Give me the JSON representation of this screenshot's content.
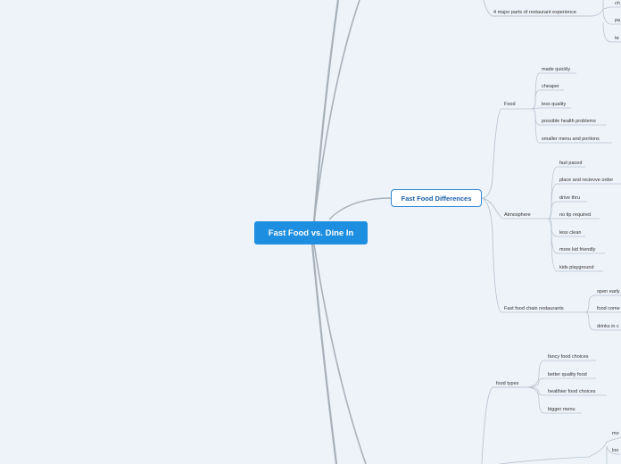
{
  "root": {
    "label": "Fast Food vs. Dine In"
  },
  "main_topic": {
    "label": "Fast Food Differences"
  },
  "top_partial": {
    "label": "4 major parts of restaurant experience",
    "children": [
      "ch",
      "pa",
      "ta"
    ]
  },
  "food": {
    "label": "Food",
    "children": [
      "made quickly",
      "cheaper",
      "less quality",
      "possible health problems",
      "smaller menu and portions"
    ]
  },
  "atmosphere": {
    "label": "Atmosphere",
    "children": [
      "fast paced",
      "place and recievve order",
      "drive thru",
      "no tip required",
      "less clean",
      "more kid friendly",
      "kids playground"
    ]
  },
  "chains": {
    "label": "Fast food chain restaurants",
    "children": [
      "open early",
      "food come",
      "drinks in c"
    ]
  },
  "food_types": {
    "label": "food types",
    "children": [
      "fancy food choices",
      "better quality food",
      "healthier food choices",
      "bigger menu"
    ]
  },
  "bottom_partial": {
    "children": [
      "mo",
      "loo"
    ]
  },
  "colors": {
    "branch": "#a7afb8",
    "sub_branch": "#b9c3ce",
    "root_fill": "#1e8fe0",
    "topic_border": "#2e86d6"
  }
}
